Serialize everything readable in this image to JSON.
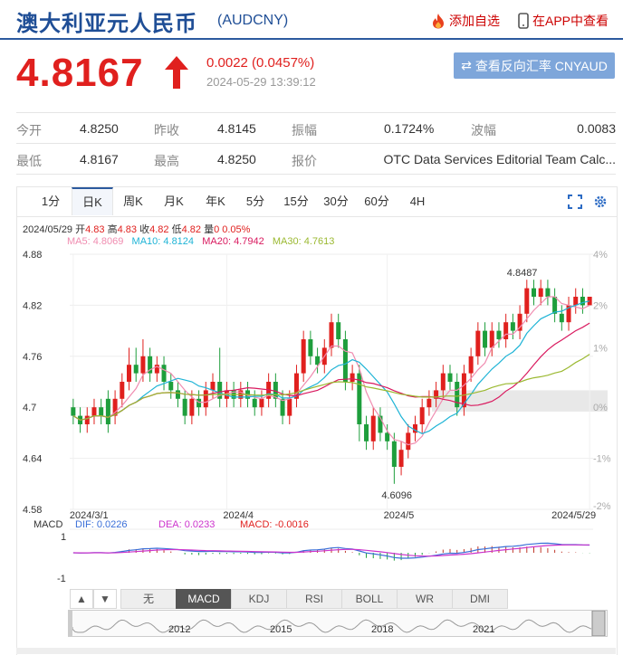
{
  "header": {
    "title": "澳大利亚元人民币",
    "code": "(AUDCNY)",
    "add_watch": "添加自选",
    "app_view": "在APP中查看"
  },
  "quote": {
    "price": "4.8167",
    "change": "0.0022 (0.0457%)",
    "datetime": "2024-05-29 13:39:12",
    "reverse_button": "查看反向汇率 CNYAUD"
  },
  "stats": {
    "row1": [
      {
        "label": "今开",
        "value": "4.8250"
      },
      {
        "label": "昨收",
        "value": "4.8145"
      },
      {
        "label": "振幅",
        "value": "0.1724%"
      },
      {
        "label": "波幅",
        "value": "0.0083"
      }
    ],
    "row2": [
      {
        "label": "最低",
        "value": "4.8167"
      },
      {
        "label": "最高",
        "value": "4.8250"
      },
      {
        "label": "报价",
        "value": "OTC Data Services Editorial Team Calc..."
      }
    ]
  },
  "chart_tabs": [
    "1分",
    "日K",
    "周K",
    "月K",
    "年K",
    "5分",
    "15分",
    "30分",
    "60分",
    "4H"
  ],
  "active_tab": "日K",
  "kline_info": {
    "date": "2024/05/29",
    "open_label": "开",
    "open": "4.83",
    "high_label": "高",
    "high": "4.83",
    "close_label": "收",
    "close": "4.82",
    "low_label": "低",
    "low": "4.82",
    "vol_label": "量",
    "vol": "0",
    "pct": "0.05%"
  },
  "ma_info": {
    "ma5": "MA5: 4.8069",
    "ma10": "MA10: 4.8124",
    "ma20": "MA20: 4.7942",
    "ma30": "MA30: 4.7613"
  },
  "macd_info": {
    "label": "MACD",
    "dif": "DIF: 0.0226",
    "dea": "DEA: 0.0233",
    "macd": "MACD: -0.0016"
  },
  "indicator_tabs": [
    "无",
    "MACD",
    "KDJ",
    "RSI",
    "BOLL",
    "WR",
    "DMI"
  ],
  "active_indicator": "MACD",
  "nav_years": [
    "2012",
    "2015",
    "2018",
    "2021"
  ],
  "colors": {
    "up": "#e0201e",
    "down": "#1e9e3c",
    "ma5": "#f08cb0",
    "ma10": "#1fb4d6",
    "ma20": "#d91a5f",
    "ma30": "#9bb931",
    "brand": "#1f4e96"
  },
  "chart_data": {
    "type": "candlestick",
    "y_ticks": [
      "4.88",
      "4.82",
      "4.76",
      "4.7",
      "4.64",
      "4.58"
    ],
    "pct_ticks": [
      "4%",
      "2%",
      "1%",
      "0%",
      "-1%",
      "-2%"
    ],
    "x_ticks": [
      "2024/3/1",
      "2024/4",
      "2024/5",
      "2024/5/29"
    ],
    "ylim": [
      4.58,
      4.88
    ],
    "high_annotation": "4.8487",
    "low_annotation": "4.6096",
    "macd_ticks": [
      "1",
      "-1"
    ],
    "candles": [
      [
        4.7,
        4.69,
        4.71,
        4.68
      ],
      [
        4.69,
        4.68,
        4.7,
        4.67
      ],
      [
        4.68,
        4.69,
        4.7,
        4.67
      ],
      [
        4.69,
        4.7,
        4.71,
        4.68
      ],
      [
        4.7,
        4.69,
        4.71,
        4.68
      ],
      [
        4.71,
        4.68,
        4.72,
        4.67
      ],
      [
        4.69,
        4.71,
        4.72,
        4.68
      ],
      [
        4.71,
        4.73,
        4.74,
        4.7
      ],
      [
        4.73,
        4.75,
        4.77,
        4.72
      ],
      [
        4.75,
        4.74,
        4.77,
        4.73
      ],
      [
        4.74,
        4.76,
        4.78,
        4.73
      ],
      [
        4.76,
        4.74,
        4.77,
        4.73
      ],
      [
        4.74,
        4.75,
        4.76,
        4.73
      ],
      [
        4.75,
        4.73,
        4.76,
        4.72
      ],
      [
        4.73,
        4.72,
        4.74,
        4.71
      ],
      [
        4.72,
        4.71,
        4.73,
        4.7
      ],
      [
        4.71,
        4.69,
        4.72,
        4.68
      ],
      [
        4.69,
        4.71,
        4.72,
        4.68
      ],
      [
        4.71,
        4.7,
        4.72,
        4.69
      ],
      [
        4.7,
        4.72,
        4.73,
        4.69
      ],
      [
        4.72,
        4.73,
        4.74,
        4.71
      ],
      [
        4.73,
        4.71,
        4.77,
        4.7
      ],
      [
        4.71,
        4.72,
        4.73,
        4.7
      ],
      [
        4.72,
        4.71,
        4.73,
        4.7
      ],
      [
        4.71,
        4.72,
        4.73,
        4.7
      ],
      [
        4.72,
        4.71,
        4.73,
        4.7
      ],
      [
        4.71,
        4.7,
        4.72,
        4.69
      ],
      [
        4.7,
        4.71,
        4.72,
        4.69
      ],
      [
        4.71,
        4.73,
        4.74,
        4.7
      ],
      [
        4.73,
        4.71,
        4.74,
        4.7
      ],
      [
        4.71,
        4.69,
        4.72,
        4.68
      ],
      [
        4.69,
        4.71,
        4.72,
        4.68
      ],
      [
        4.71,
        4.74,
        4.75,
        4.7
      ],
      [
        4.74,
        4.78,
        4.79,
        4.73
      ],
      [
        4.78,
        4.76,
        4.79,
        4.75
      ],
      [
        4.76,
        4.75,
        4.77,
        4.74
      ],
      [
        4.75,
        4.77,
        4.78,
        4.74
      ],
      [
        4.77,
        4.8,
        4.81,
        4.76
      ],
      [
        4.8,
        4.78,
        4.81,
        4.77
      ],
      [
        4.78,
        4.73,
        4.79,
        4.72
      ],
      [
        4.73,
        4.74,
        4.75,
        4.72
      ],
      [
        4.74,
        4.68,
        4.75,
        4.66
      ],
      [
        4.68,
        4.66,
        4.69,
        4.65
      ],
      [
        4.66,
        4.69,
        4.7,
        4.65
      ],
      [
        4.69,
        4.67,
        4.7,
        4.66
      ],
      [
        4.67,
        4.66,
        4.68,
        4.65
      ],
      [
        4.66,
        4.63,
        4.67,
        4.61
      ],
      [
        4.63,
        4.65,
        4.66,
        4.62
      ],
      [
        4.65,
        4.67,
        4.68,
        4.64
      ],
      [
        4.67,
        4.68,
        4.69,
        4.66
      ],
      [
        4.68,
        4.7,
        4.71,
        4.67
      ],
      [
        4.7,
        4.71,
        4.72,
        4.69
      ],
      [
        4.71,
        4.72,
        4.73,
        4.7
      ],
      [
        4.72,
        4.74,
        4.75,
        4.71
      ],
      [
        4.74,
        4.73,
        4.75,
        4.72
      ],
      [
        4.73,
        4.7,
        4.74,
        4.69
      ],
      [
        4.7,
        4.74,
        4.75,
        4.69
      ],
      [
        4.74,
        4.76,
        4.77,
        4.73
      ],
      [
        4.76,
        4.79,
        4.8,
        4.75
      ],
      [
        4.79,
        4.77,
        4.8,
        4.76
      ],
      [
        4.77,
        4.79,
        4.8,
        4.76
      ],
      [
        4.79,
        4.78,
        4.8,
        4.77
      ],
      [
        4.78,
        4.8,
        4.81,
        4.77
      ],
      [
        4.8,
        4.79,
        4.81,
        4.78
      ],
      [
        4.79,
        4.81,
        4.82,
        4.78
      ],
      [
        4.81,
        4.84,
        4.85,
        4.8
      ],
      [
        4.84,
        4.83,
        4.85,
        4.82
      ],
      [
        4.83,
        4.84,
        4.85,
        4.82
      ],
      [
        4.84,
        4.83,
        4.85,
        4.82
      ],
      [
        4.83,
        4.81,
        4.84,
        4.8
      ],
      [
        4.81,
        4.8,
        4.82,
        4.79
      ],
      [
        4.8,
        4.82,
        4.83,
        4.79
      ],
      [
        4.82,
        4.83,
        4.84,
        4.81
      ],
      [
        4.83,
        4.82,
        4.84,
        4.81
      ],
      [
        4.82,
        4.83,
        4.83,
        4.82
      ]
    ]
  }
}
